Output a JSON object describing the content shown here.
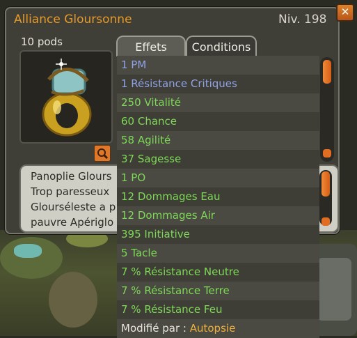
{
  "window": {
    "title": "Alliance Gloursonne",
    "level": "Niv. 198",
    "close_icon": "close-icon",
    "weight": "10 pods"
  },
  "tabs": [
    {
      "label": "Effets",
      "active": true
    },
    {
      "label": "Conditions",
      "active": false
    }
  ],
  "effects": [
    {
      "text": "1 PM",
      "color": "blue"
    },
    {
      "text": "1 Résistance Critiques",
      "color": "blue"
    },
    {
      "text": "250 Vitalité",
      "color": "green"
    },
    {
      "text": "60 Chance",
      "color": "green"
    },
    {
      "text": "58 Agilité",
      "color": "green"
    },
    {
      "text": "37 Sagesse",
      "color": "green"
    },
    {
      "text": "1 PO",
      "color": "green"
    },
    {
      "text": "12 Dommages Eau",
      "color": "green"
    },
    {
      "text": "12 Dommages Air",
      "color": "green"
    },
    {
      "text": "395 Initiative",
      "color": "green"
    },
    {
      "text": "5 Tacle",
      "color": "green"
    },
    {
      "text": "7 % Résistance Neutre",
      "color": "green"
    },
    {
      "text": "7 % Résistance Terre",
      "color": "green"
    },
    {
      "text": "7 % Résistance Feu",
      "color": "green"
    }
  ],
  "modified_by": {
    "label": "Modifié par : ",
    "value": "Autopsie"
  },
  "description": [
    "Panoplie Glours",
    "Trop paresseux",
    "Glourséleste a p",
    "pauvre Apériglo"
  ],
  "colors": {
    "title": "#e69a2a",
    "effect_green": "#7ed957",
    "effect_blue": "#8fa3e6",
    "accent": "#e0782a"
  }
}
